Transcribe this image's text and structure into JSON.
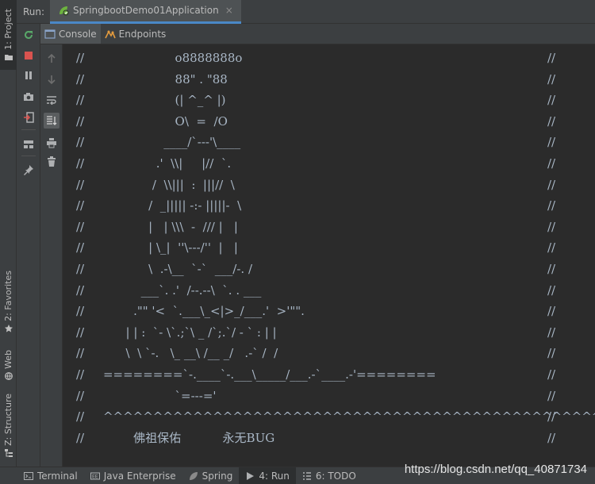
{
  "left_strip": {
    "tabs": [
      {
        "label": "1: Project"
      },
      {
        "label": "2: Favorites"
      },
      {
        "label": "Web"
      },
      {
        "label": "Z: Structure"
      }
    ]
  },
  "run_panel": {
    "label": "Run:",
    "config_tab": {
      "label": "SpringbootDemo01Application",
      "close": "×"
    },
    "sub_tabs": [
      {
        "label": "Console"
      },
      {
        "label": "Endpoints"
      }
    ]
  },
  "console": {
    "lines": [
      {
        "text": "                        o8888888o",
        "right": "//"
      },
      {
        "text": "                        88\" . \"88",
        "right": "//"
      },
      {
        "text": "                        (| ^_^ |)",
        "right": "//"
      },
      {
        "text": "                        O\\  =  /O",
        "right": "//"
      },
      {
        "text": "                     ____/`---'\\____",
        "right": "//"
      },
      {
        "text": "                   .'  \\\\|     |//  `.",
        "right": "//"
      },
      {
        "text": "                  /  \\\\|||  :  |||//  \\",
        "right": "//"
      },
      {
        "text": "                 /  _||||| -:- |||||-  \\",
        "right": "//"
      },
      {
        "text": "                 |   | \\\\\\  -  /// |   |",
        "right": "//"
      },
      {
        "text": "                 | \\_|  ''\\---/''  |   |",
        "right": "//"
      },
      {
        "text": "                 \\  .-\\__  `-`  ___/-. /",
        "right": "//"
      },
      {
        "text": "               ___`. .'  /--.--\\  `. . ___",
        "right": "//"
      },
      {
        "text": "             .\"\" '<  `.___\\_<|>_/___.'  >'\"\".",
        "right": "//"
      },
      {
        "text": "           | | :  `- \\`.;`\\ _ /`;.`/ - ` : | |",
        "right": "//"
      },
      {
        "text": "           \\  \\ `-.   \\_ __\\ /__ _/   .-` /  /",
        "right": "//"
      },
      {
        "text": "     ========`-.____`-.___\\_____/___.-`____.-'========",
        "right": "//"
      },
      {
        "text": "                        `=---='",
        "right": "//"
      },
      {
        "text": "     ^^^^^^^^^^^^^^^^^^^^^^^^^^^^^^^^^^^^^^^^^^^^^^^^^^",
        "right": "//"
      },
      {
        "text": "             佛祖保佑           永无BUG",
        "right": "//"
      }
    ],
    "prefix": "//"
  },
  "bottom_bar": {
    "tabs": [
      {
        "label": "Terminal"
      },
      {
        "label": "Java Enterprise"
      },
      {
        "label": "Spring"
      },
      {
        "label": "4: Run"
      },
      {
        "label": "6: TODO"
      }
    ]
  },
  "watermark": "https://blog.csdn.net/qq_40871734",
  "colors": {
    "background": "#2b2b2b",
    "panel": "#3c3f41",
    "console_text": "#a9b7c6",
    "accent": "#4a88c7"
  }
}
